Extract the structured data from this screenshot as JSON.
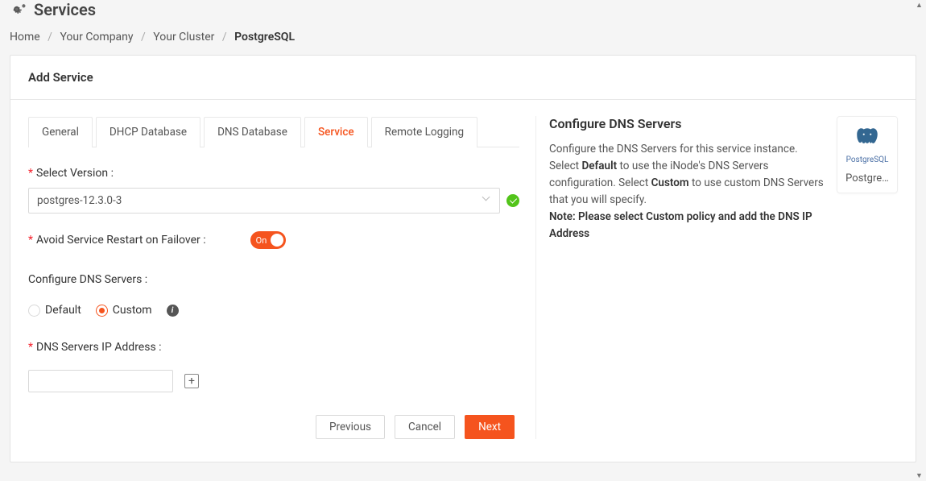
{
  "page": {
    "title": "Services"
  },
  "breadcrumb": {
    "items": [
      "Home",
      "Your Company",
      "Your Cluster"
    ],
    "current": "PostgreSQL"
  },
  "card": {
    "title": "Add Service"
  },
  "tabs": [
    {
      "label": "General",
      "active": false
    },
    {
      "label": "DHCP Database",
      "active": false
    },
    {
      "label": "DNS Database",
      "active": false
    },
    {
      "label": "Service",
      "active": true
    },
    {
      "label": "Remote Logging",
      "active": false
    }
  ],
  "form": {
    "version_label": "Select Version",
    "version_value": "postgres-12.3.0-3",
    "avoid_restart_label": "Avoid Service Restart on Failover",
    "avoid_restart_state": "On",
    "dns_section_label": "Configure DNS Servers",
    "radio_default": "Default",
    "radio_custom": "Custom",
    "dns_selected": "custom",
    "dns_ip_label": "DNS Servers IP Address",
    "dns_ip_value": ""
  },
  "footer": {
    "previous": "Previous",
    "cancel": "Cancel",
    "next": "Next"
  },
  "info_panel": {
    "title": "Configure DNS Servers",
    "line1_a": "Configure the DNS Servers for this service instance. Select ",
    "line1_b": "Default",
    "line1_c": " to use the iNode's DNS Servers configuration. Select ",
    "line1_d": "Custom",
    "line1_e": " to use custom DNS Servers that you will specify.",
    "note": "Note: Please select Custom policy and add the DNS IP Address"
  },
  "service_card": {
    "brand": "PostgreSQL",
    "label": "Postgre…"
  }
}
